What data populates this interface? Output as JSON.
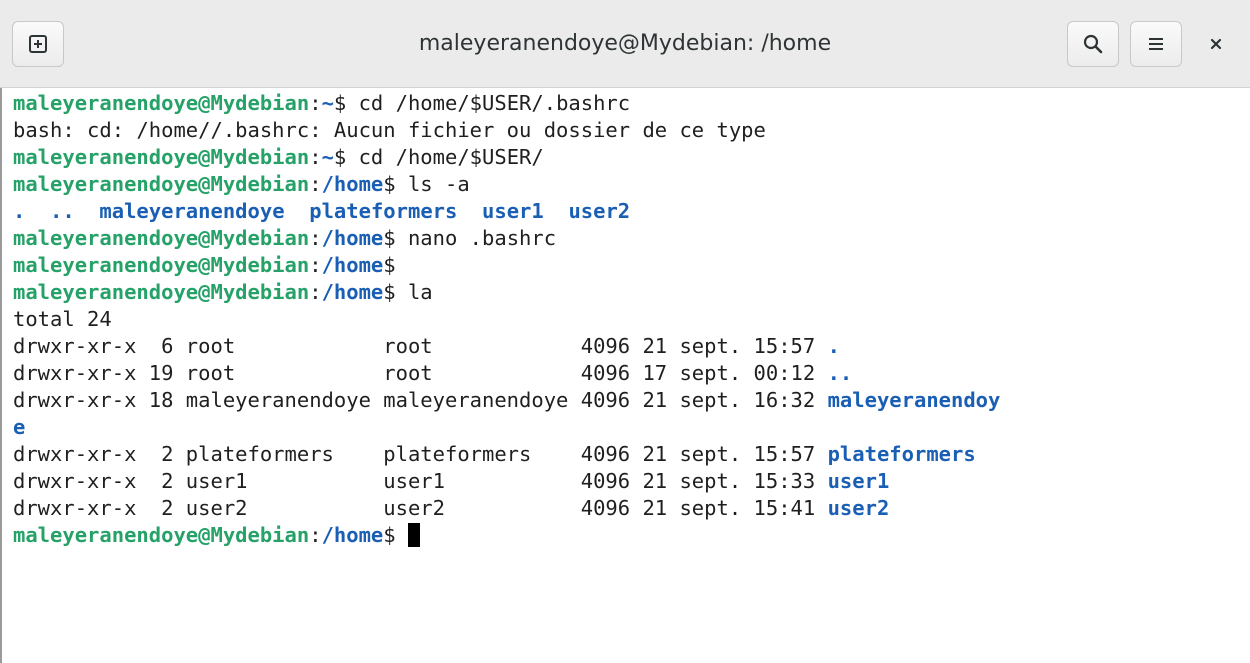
{
  "window": {
    "title": "maleyeranendoye@Mydebian: /home"
  },
  "icons": {
    "new_tab": "new-tab-icon",
    "search": "search-icon",
    "menu": "hamburger-menu-icon",
    "close": "close-icon"
  },
  "colors": {
    "user_host": "#26a269",
    "path": "#1a5fb4",
    "directory": "#1a5fb4",
    "text": "#1f1f1f"
  },
  "terminal": {
    "lines": [
      {
        "type": "prompt",
        "user": "maleyeranendoye@Mydebian",
        "colon": ":",
        "path": "~",
        "dollar": "$",
        "command": " cd /home/$USER/.bashrc"
      },
      {
        "type": "output",
        "text": "bash: cd: /home//.bashrc: Aucun fichier ou dossier de ce type"
      },
      {
        "type": "prompt",
        "user": "maleyeranendoye@Mydebian",
        "colon": ":",
        "path": "~",
        "dollar": "$",
        "command": " cd /home/$USER/"
      },
      {
        "type": "prompt",
        "user": "maleyeranendoye@Mydebian",
        "colon": ":",
        "path": "/home",
        "dollar": "$",
        "command": " ls -a"
      },
      {
        "type": "ls",
        "entries": [
          ".",
          "..",
          "maleyeranendoye",
          "plateformers",
          "user1",
          "user2"
        ]
      },
      {
        "type": "prompt",
        "user": "maleyeranendoye@Mydebian",
        "colon": ":",
        "path": "/home",
        "dollar": "$",
        "command": " nano .bashrc"
      },
      {
        "type": "prompt",
        "user": "maleyeranendoye@Mydebian",
        "colon": ":",
        "path": "/home",
        "dollar": "$",
        "command": ""
      },
      {
        "type": "prompt",
        "user": "maleyeranendoye@Mydebian",
        "colon": ":",
        "path": "/home",
        "dollar": "$",
        "command": " la"
      },
      {
        "type": "output",
        "text": "total 24"
      },
      {
        "type": "listing",
        "meta": "drwxr-xr-x  6 root            root            4096 21 sept. 15:57 ",
        "name": "."
      },
      {
        "type": "listing",
        "meta": "drwxr-xr-x 19 root            root            4096 17 sept. 00:12 ",
        "name": ".."
      },
      {
        "type": "listing",
        "meta": "drwxr-xr-x 18 maleyeranendoye maleyeranendoye 4096 21 sept. 16:32 ",
        "name": "maleyeranendoy"
      },
      {
        "type": "listing",
        "meta": "",
        "name": "e"
      },
      {
        "type": "listing",
        "meta": "drwxr-xr-x  2 plateformers    plateformers    4096 21 sept. 15:57 ",
        "name": "plateformers"
      },
      {
        "type": "listing",
        "meta": "drwxr-xr-x  2 user1           user1           4096 21 sept. 15:33 ",
        "name": "user1"
      },
      {
        "type": "listing",
        "meta": "drwxr-xr-x  2 user2           user2           4096 21 sept. 15:41 ",
        "name": "user2"
      },
      {
        "type": "prompt",
        "user": "maleyeranendoye@Mydebian",
        "colon": ":",
        "path": "/home",
        "dollar": "$",
        "command": " ",
        "cursor": true
      }
    ]
  }
}
